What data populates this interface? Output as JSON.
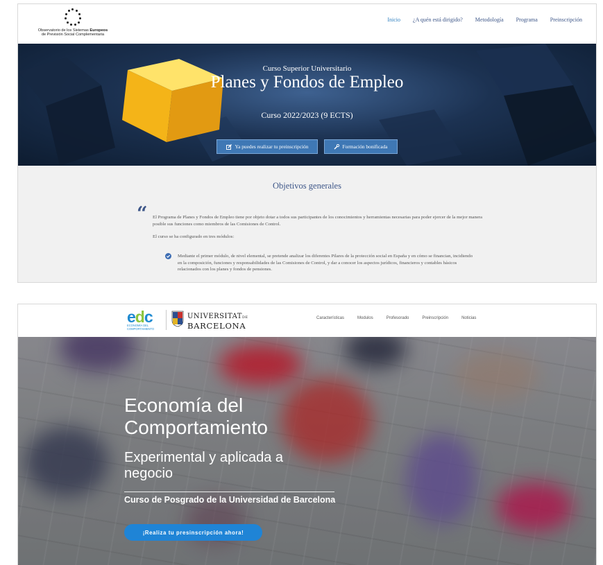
{
  "shot1": {
    "logo": {
      "line1_pre": "Observatorio de los Sistemas ",
      "line1_bold": "Europeos",
      "line2": "de Previsión Social Complementaria"
    },
    "menu": [
      "Inicio",
      "¿A quén está dirigido?",
      "Metodología",
      "Programa",
      "Preinscripción"
    ],
    "active_menu": "Inicio",
    "hero": {
      "overline": "Curso Superior Universitario",
      "title": "Planes y Fondos de Empleo",
      "course": "Curso 2022/2023 (9 ECTS)",
      "button_primary": "Ya puedes realizar tu preinscripción",
      "button_secondary": "Formación bonificada"
    },
    "content": {
      "section_title": "Objetivos generales",
      "paragraph1": "El Programa de Planes y Fondos de Empleo tiene por objeto dotar a todos sus participantes de los conocimientos y herramientas necesarias para poder ejercer de la mejor manera posible sus funciones como miembros de las Comisiones de Control.",
      "paragraph2": "El curso se ha configurado en tres módulos:",
      "list_item1": "Mediante el primer módulo, de nivel elemental, se pretende analizar los diferentes Pilares de la protección social en España y en cómo se financian, incidiendo en la composición, funciones y responsabilidades de las Comisiones de Control, y dar a conocer los aspectos jurídicos, financieros y contables básicos relacionados con los planes y fondos de pensiones."
    },
    "colors": {
      "nav_link": "#3d5688",
      "button": "#3f78b5",
      "background": "#f1f1f1"
    }
  },
  "shot2": {
    "logo": {
      "edc": "edc",
      "edc_subtitle_line1": "ECONOMÍA DEL",
      "edc_subtitle_line2": "COMPORTAMIENTO",
      "ub_line1": "UNIVERSITAT",
      "ub_line1_suffix": "DE",
      "ub_line2": "BARCELONA"
    },
    "menu": [
      "Características",
      "Modulos",
      "Profesorado",
      "Preinscripción",
      "Noticias"
    ],
    "hero": {
      "title": "Economía del Comportamiento",
      "subtitle": "Experimental y aplicada a negocio",
      "tagline": "Curso de Posgrado de la Universidad de Barcelona",
      "cta": "¡Realiza tu presinscripción ahora!"
    },
    "colors": {
      "cta": "#1f84d6",
      "edc_blue": "#1f8ad0",
      "edc_green": "#8cc63f"
    }
  }
}
